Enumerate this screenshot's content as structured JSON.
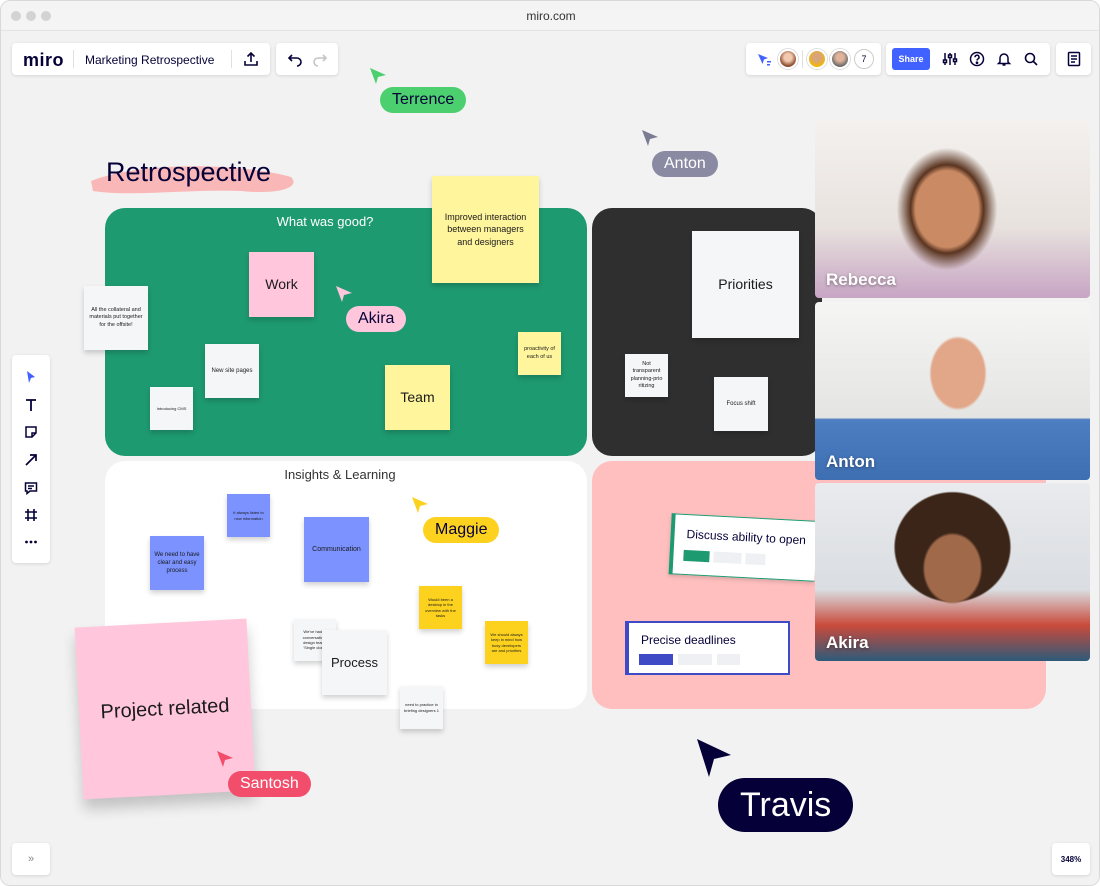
{
  "browser": {
    "url": "miro.com"
  },
  "header": {
    "logo": "miro",
    "board_title": "Marketing Retrospective",
    "share_label": "Share",
    "collaborator_count": "7"
  },
  "canvas": {
    "heading": "Retrospective",
    "frames": {
      "good": {
        "title": "What was good?"
      },
      "insights": {
        "title": "Insights & Learning"
      }
    },
    "stickies": {
      "improved": "Improved interaction between managers and designers",
      "work": "Work",
      "collateral": "All the collateral and materials put together for the offsite!",
      "new_site": "New site pages",
      "introducing": "Introducing CMS",
      "team": "Team",
      "proactivity": "proactivity of each of us",
      "priorities": "Priorities",
      "not_transparent": "Not transparent planning-prio ritizing",
      "focus_shift": "Focus shift",
      "always_listen": "It always listen to new information",
      "clear_process": "We need to have clear and easy process",
      "communication": "Communication",
      "desktop": "Would been a desktop in the overview with the tasks",
      "keep_mind": "We should always keep in mind how busy developers are and priorities",
      "conversations": "We've had to conversations design teams 'Single cloud'",
      "process": "Process",
      "practice": "need to practice in briefing designers 1",
      "project_related": "Project related"
    },
    "cards": {
      "discuss": "Discuss ability to open",
      "deadlines": "Precise deadlines"
    },
    "cursors": {
      "terrence": "Terrence",
      "anton": "Anton",
      "akira": "Akira",
      "maggie": "Maggie",
      "santosh": "Santosh",
      "travis": "Travis"
    }
  },
  "videos": [
    {
      "name": "Rebecca"
    },
    {
      "name": "Anton"
    },
    {
      "name": "Akira"
    }
  ],
  "footer": {
    "zoom": "348%",
    "expand_icon": "»"
  },
  "colors": {
    "accent": "#4262ff",
    "frame_green": "#1e9a70",
    "frame_dark": "#2f2f2f",
    "frame_pink": "#ffbfbf",
    "sticky_yellow": "#fff59d",
    "sticky_pink": "#ffc6dc",
    "sticky_blue": "#7b92ff",
    "sticky_orange": "#fdd21f",
    "travis_bg": "#050038"
  },
  "icons": [
    "upload-icon",
    "undo-icon",
    "redo-icon",
    "reactions-icon",
    "settings-icon",
    "help-icon",
    "bell-icon",
    "search-icon",
    "notes-icon",
    "select-icon",
    "text-icon",
    "sticky-note-icon",
    "arrow-icon",
    "comment-icon",
    "frame-icon",
    "more-icon"
  ]
}
